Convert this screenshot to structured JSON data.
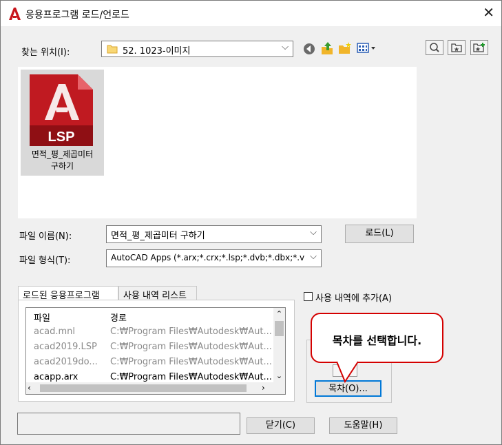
{
  "window": {
    "title": "응용프로그램 로드/언로드",
    "close_symbol": "✕"
  },
  "lookin": {
    "label": "찾는 위치(I):",
    "value": "52. 1023-이미지"
  },
  "files": [
    {
      "name_line1": "면적_평_제곱미터",
      "name_line2": "구하기",
      "badge": "LSP"
    }
  ],
  "filename": {
    "label": "파일 이름(N):",
    "value": "면적_평_제곱미터 구하기"
  },
  "filetype": {
    "label": "파일 형식(T):",
    "value": "AutoCAD Apps (*.arx;*.crx;*.lsp;*.dvb;*.dbx;*.v"
  },
  "load_button": "로드(L)",
  "tabs": {
    "loaded": "로드된 응용프로그램",
    "history": "사용 내역 리스트"
  },
  "add_history": "사용 내역에 추가(A)",
  "list": {
    "col_file": "파일",
    "col_path": "경로",
    "rows": [
      {
        "file": "acad.mnl",
        "path": "C:₩Program Files₩Autodesk₩Aut..."
      },
      {
        "file": "acad2019.LSP",
        "path": "C:₩Program Files₩Autodesk₩Aut..."
      },
      {
        "file": "acad2019do...",
        "path": "C:₩Program Files₩Autodesk₩Aut..."
      },
      {
        "file": "acapp.arx",
        "path": "C:₩Program Files₩Autodesk₩Aut..."
      }
    ]
  },
  "contents_button": "목차(O)...",
  "callout_text": "목차를 선택합니다.",
  "close_button": "닫기(C)",
  "help_button": "도움말(H)",
  "colors": {
    "accent_red": "#d40000",
    "list_selection": "#d9d9d9"
  }
}
